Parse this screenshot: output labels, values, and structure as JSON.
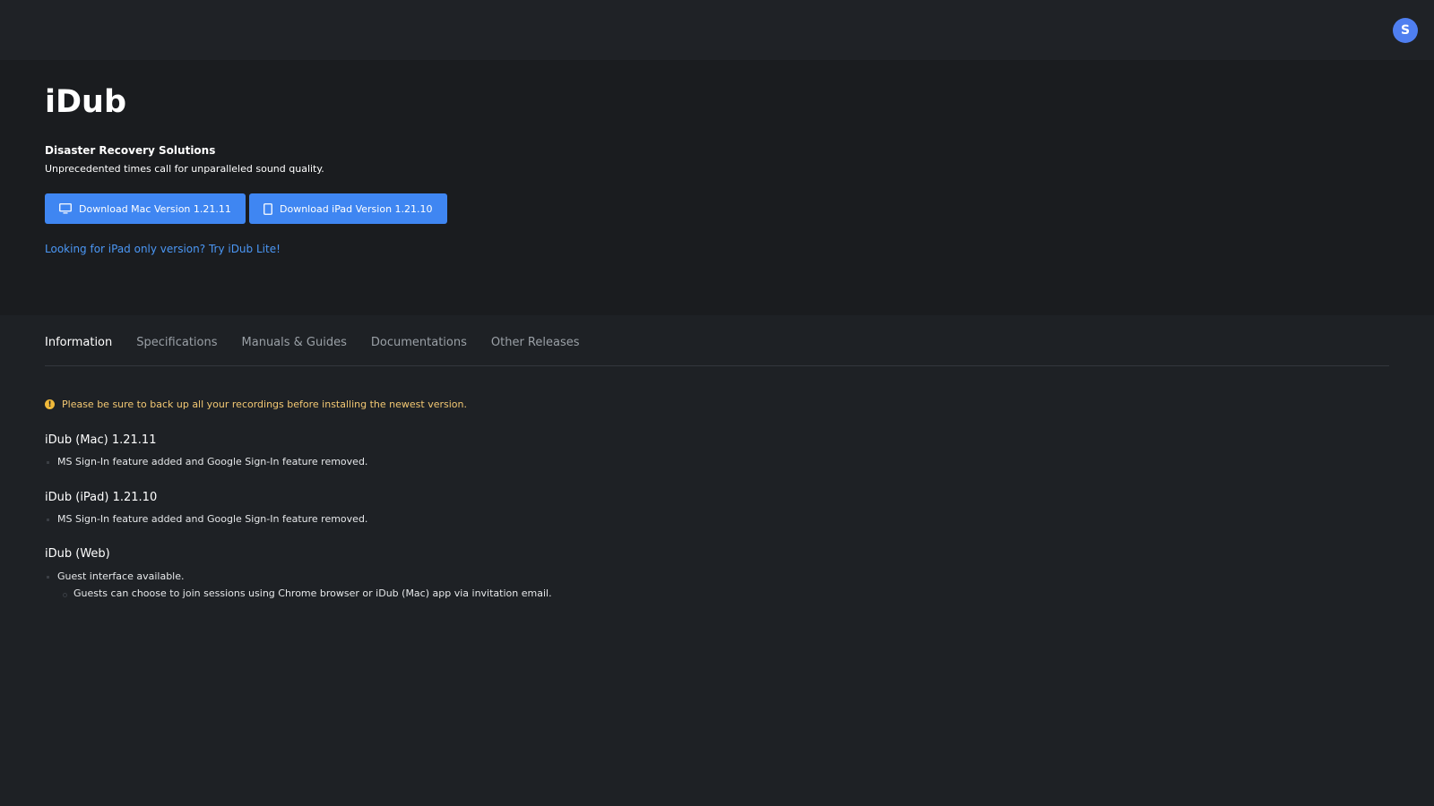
{
  "header": {
    "avatar_initial": "S"
  },
  "hero": {
    "title": "iDub",
    "subtitle": "Disaster Recovery Solutions",
    "tagline": "Unprecedented times call for unparalleled sound quality.",
    "mac_button_label": "Download Mac Version 1.21.11",
    "ipad_button_label": "Download iPad Version 1.21.10",
    "lite_link": "Looking for iPad only version? Try iDub Lite!",
    "button_color": "#3f86f2",
    "link_color": "#4b97f5"
  },
  "tabs": [
    {
      "label": "Information",
      "active": true
    },
    {
      "label": "Specifications",
      "active": false
    },
    {
      "label": "Manuals & Guides",
      "active": false
    },
    {
      "label": "Documentations",
      "active": false
    },
    {
      "label": "Other Releases",
      "active": false
    }
  ],
  "content": {
    "notice": "Please be sure to back up all your recordings before installing the newest version.",
    "sections": [
      {
        "title": "iDub (Mac) 1.21.11",
        "items": [
          "MS Sign-In feature added and Google Sign-In feature removed."
        ]
      },
      {
        "title": "iDub (iPad) 1.21.10",
        "items": [
          "MS Sign-In feature added and Google Sign-In feature removed."
        ]
      },
      {
        "title": "iDub (Web)",
        "items": [
          "Guest interface available."
        ],
        "subitems": [
          "Guests can choose to join sessions using Chrome browser or iDub (Mac) app via invitation email."
        ]
      }
    ]
  },
  "icons": {
    "mac_button_icon": "monitor-icon",
    "ipad_button_icon": "tablet-icon",
    "notice_icon": "warning-icon"
  }
}
